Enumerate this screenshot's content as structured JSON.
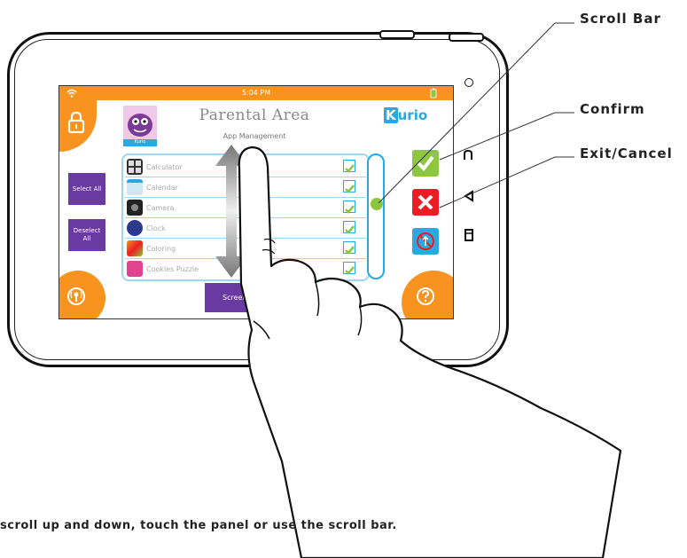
{
  "status_bar": {
    "time": "5:04 PM"
  },
  "header": {
    "title": "Parental Area",
    "subtitle": "App Management",
    "avatar_label": "Kurio",
    "logo_k": "K",
    "logo_rest": "urio"
  },
  "left_menu": {
    "select_all": "Select All",
    "deselect_all_line1": "Deselect",
    "deselect_all_line2": "All"
  },
  "apps": [
    {
      "name": "Calculator",
      "checked": true
    },
    {
      "name": "Calendar",
      "checked": true
    },
    {
      "name": "Camera",
      "checked": true
    },
    {
      "name": "Clock",
      "checked": true
    },
    {
      "name": "Coloring",
      "checked": true
    },
    {
      "name": "Cookies Puzzle",
      "checked": true
    }
  ],
  "bottom": {
    "screen_lock_label": "Screen Lo"
  },
  "callouts": {
    "scroll_bar": "Scroll Bar",
    "confirm": "Confirm",
    "exit_cancel": "Exit/Cancel"
  },
  "caption": "scroll up and down, touch the panel or use the scroll bar.",
  "colors": {
    "orange": "#f7931e",
    "purple": "#6a3aa3",
    "green": "#8dc63f",
    "red": "#ed1c24",
    "blue": "#27a9e1",
    "list_border": "#9fd7ef"
  },
  "icons": {
    "wifi": "wifi-icon",
    "battery": "battery-icon",
    "lock": "lock-icon",
    "confirm": "checkmark-icon",
    "cancel": "close-icon",
    "no_internet": "no-internet-icon",
    "help": "help-icon",
    "parental": "parental-control-icon"
  }
}
